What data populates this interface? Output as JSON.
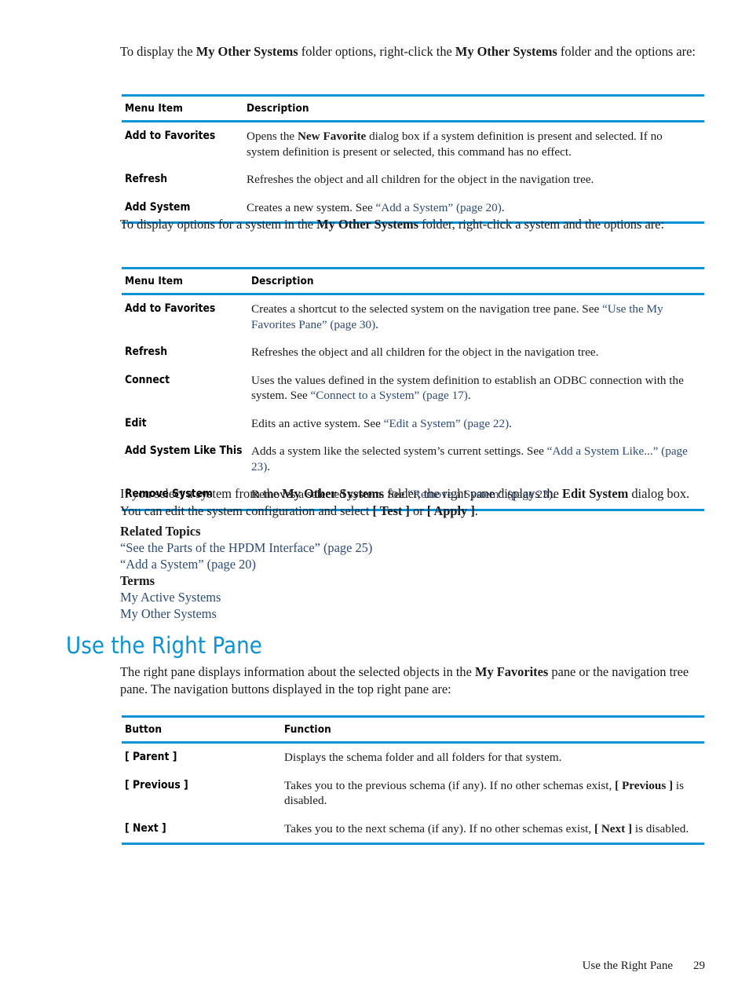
{
  "page": {
    "footer_title": "Use the Right Pane",
    "footer_page_number": "29",
    "accent_color": "#0b93d5",
    "link_color": "#2c4a77"
  },
  "intro1": {
    "part1": "To display the ",
    "bold1": "My Other Systems",
    "part2": " folder options, right-click the ",
    "bold2": "My Other Systems",
    "part3": " folder and the options are:"
  },
  "table1": {
    "headers": {
      "col1": "Menu Item",
      "col2": "Description"
    },
    "rows": [
      {
        "item": "Add to Favorites",
        "desc_part1": "Opens the ",
        "desc_bold": "New Favorite",
        "desc_part2": " dialog box if a system definition is present and selected. If no system definition is present or selected, this command has no effect."
      },
      {
        "item": "Refresh",
        "desc_part1": "Refreshes the object and all children for the object in the navigation tree.",
        "desc_bold": "",
        "desc_part2": ""
      },
      {
        "item": "Add System",
        "desc_part1": "Creates a new system. See ",
        "link": "“Add a System” (page 20)",
        "desc_part2": "."
      }
    ]
  },
  "intro2": {
    "part1": "To display options for a system in the ",
    "bold1": "My Other Systems",
    "part2": " folder, right-click a system and the options are:"
  },
  "table2": {
    "headers": {
      "col1": "Menu Item",
      "col2": "Description"
    },
    "rows": [
      {
        "item": "Add to Favorites",
        "desc_part1": "Creates a shortcut to the selected system on the navigation tree pane. See ",
        "link": "“Use the My Favorites Pane” (page 30)",
        "desc_part2": "."
      },
      {
        "item": "Refresh",
        "desc_part1": "Refreshes the object and all children for the object in the navigation tree.",
        "link": "",
        "desc_part2": ""
      },
      {
        "item": "Connect",
        "desc_part1": "Uses the values defined in the system definition to establish an ODBC connection with the system. See ",
        "link": "“Connect to a System” (page 17)",
        "desc_part2": "."
      },
      {
        "item": "Edit",
        "desc_part1": "Edits an active system. See ",
        "link": "“Edit a System” (page 22)",
        "desc_part2": "."
      },
      {
        "item": "Add System Like This",
        "desc_part1": "Adds a system like the selected system’s current settings. See ",
        "link": "“Add a System Like...” (page 23)",
        "desc_part2": "."
      },
      {
        "item": "Remove System",
        "desc_part1": "Removes a selected system. See ",
        "link": "“Remove a System” (page 23)",
        "desc_part2": "."
      }
    ]
  },
  "intro3": {
    "part1": "If you select a system from the ",
    "bold1": "My Other Systems",
    "part2": " folder, the right pane displays the ",
    "bold2": "Edit System",
    "part3": " dialog box. You can edit the system configuration and select ",
    "bold3": "[ Test ]",
    "part4": " or ",
    "bold4": "[ Apply ]",
    "part5": "."
  },
  "related": {
    "heading": "Related Topics",
    "links": [
      "“See the Parts of the HPDM Interface” (page 25)",
      "“Add a System” (page 20)"
    ],
    "terms_heading": "Terms",
    "terms": [
      "My Active Systems",
      "My Other Systems"
    ]
  },
  "section": {
    "heading": "Use the Right Pane",
    "intro_part1": "The right pane displays information about the selected objects in the ",
    "intro_bold": "My Favorites",
    "intro_part2": " pane or the navigation tree pane. The navigation buttons displayed in the top right pane are:"
  },
  "table3": {
    "headers": {
      "col1": "Button",
      "col2": "Function"
    },
    "rows": [
      {
        "item": "[ Parent ]",
        "desc_part1": "Displays the schema folder and all folders for that system.",
        "desc_bold": "",
        "desc_part2": ""
      },
      {
        "item": "[ Previous ]",
        "desc_part1": "Takes you to the previous schema (if any). If no other schemas exist, ",
        "desc_bold": "[ Previous ]",
        "desc_part2": " is disabled."
      },
      {
        "item": "[ Next ]",
        "desc_part1": "Takes you to the next schema (if any). If no other schemas exist, ",
        "desc_bold": "[ Next ]",
        "desc_part2": " is disabled."
      }
    ]
  }
}
